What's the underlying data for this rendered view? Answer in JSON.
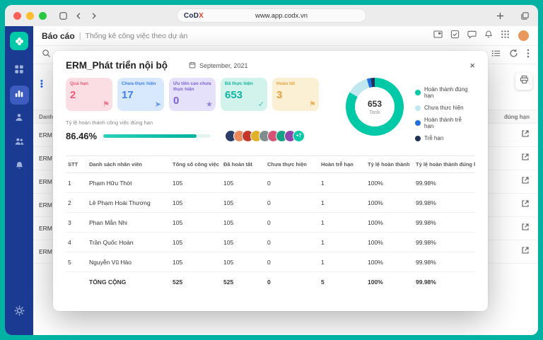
{
  "colors": {
    "frame_accent": "#00b2a1",
    "sidebar": "#1b3a91",
    "sidebar_active": "#3d5cc0",
    "brand_teal": "#00c9a7",
    "stat_overdue_bg": "#fbdde4",
    "stat_overdue_fg": "#e85c7a",
    "stat_todo_bg": "#d9e9fd",
    "stat_todo_fg": "#3d7ef0",
    "stat_priority_bg": "#e6e1fa",
    "stat_priority_fg": "#7b61d6",
    "stat_done_bg": "#d2f3ec",
    "stat_done_fg": "#10b3a0",
    "stat_complete_bg": "#fcf0d4",
    "stat_complete_fg": "#e5a23c"
  },
  "browser": {
    "url": "www.app.codx.vn",
    "logo_main": "CoD",
    "logo_accent": "X"
  },
  "app": {
    "header": {
      "title": "Báo cáo",
      "separator": "|",
      "subtitle": "Thống kê công việc theo dự án"
    },
    "background": {
      "left_header": "Danh sách",
      "right_header": "đúng hạn",
      "row_label": "ERM",
      "row_count": 6
    }
  },
  "modal": {
    "title": "ERM_Phát triển nội bộ",
    "date": "September, 2021",
    "close_glyph": "×",
    "stats": [
      {
        "label": "Quá hạn",
        "value": "2",
        "bg": "#fbdde4",
        "fg": "#e85c7a",
        "icon": "flag-icon",
        "glyph": "⚑"
      },
      {
        "label": "Chưa thực hiện",
        "value": "17",
        "bg": "#d9e9fd",
        "fg": "#3d7ef0",
        "icon": "send-icon",
        "glyph": "➤"
      },
      {
        "label": "Ưu tiên cao chưa thực hiện",
        "value": "0",
        "bg": "#e6e1fa",
        "fg": "#7b61d6",
        "icon": "star-icon",
        "glyph": "★"
      },
      {
        "label": "Đã thực hiện",
        "value": "653",
        "bg": "#d2f3ec",
        "fg": "#10b3a0",
        "icon": "check-icon",
        "glyph": "✓"
      },
      {
        "label": "Hoàn tất",
        "value": "3",
        "bg": "#fcf0d4",
        "fg": "#e5a23c",
        "icon": "flag-icon",
        "glyph": "⚑"
      }
    ],
    "progress": {
      "label": "Tỷ lệ hoàn thành công việc đúng hạn",
      "value": "86.46%",
      "percent": 86.46,
      "color": "#00b39e"
    },
    "avatars": {
      "colors": [
        "#2c3e66",
        "#e8895b",
        "#c0392b",
        "#e1b12c",
        "#7f8c8d",
        "#d35474",
        "#16a085",
        "#8e44ad"
      ],
      "more": "+7"
    },
    "donut": {
      "center_value": "653",
      "center_label": "Task",
      "segments": [
        {
          "label": "Hoàn thành đúng hạn",
          "color": "#00c9a7",
          "pct": 83.3
        },
        {
          "label": "Chưa thực hiện",
          "color": "#bfe7f0",
          "pct": 12.3
        },
        {
          "label": "Hoàn thành trễ hạn",
          "color": "#1f6fe0",
          "pct": 2.2
        },
        {
          "label": "Trễ hạn",
          "color": "#223355",
          "pct": 2.2
        }
      ]
    },
    "table": {
      "headers": [
        "STT",
        "Danh sách nhân viên",
        "Tổng số công việc",
        "Đã hoàn tất",
        "Chưa thực hiện",
        "Hoàn trễ hạn",
        "Tỷ lệ hoàn thành",
        "Tỷ lệ hoàn thành đúng hạn"
      ],
      "rows": [
        [
          "1",
          "Phạm Hữu Thời",
          "105",
          "105",
          "0",
          "1",
          "100%",
          "99.98%"
        ],
        [
          "2",
          "Lê Phạm Hoài Thương",
          "105",
          "105",
          "0",
          "1",
          "100%",
          "99.98%"
        ],
        [
          "3",
          "Phan Mẫn Nhi",
          "105",
          "105",
          "0",
          "1",
          "100%",
          "99.98%"
        ],
        [
          "4",
          "Trần Quốc Hoàn",
          "105",
          "105",
          "0",
          "1",
          "100%",
          "99.98%"
        ],
        [
          "5",
          "Nguyễn Vũ Hảo",
          "105",
          "105",
          "0",
          "1",
          "100%",
          "99.98%"
        ]
      ],
      "total": [
        "",
        "TỔNG CỘNG",
        "525",
        "525",
        "0",
        "5",
        "100%",
        "99.98%"
      ]
    }
  }
}
